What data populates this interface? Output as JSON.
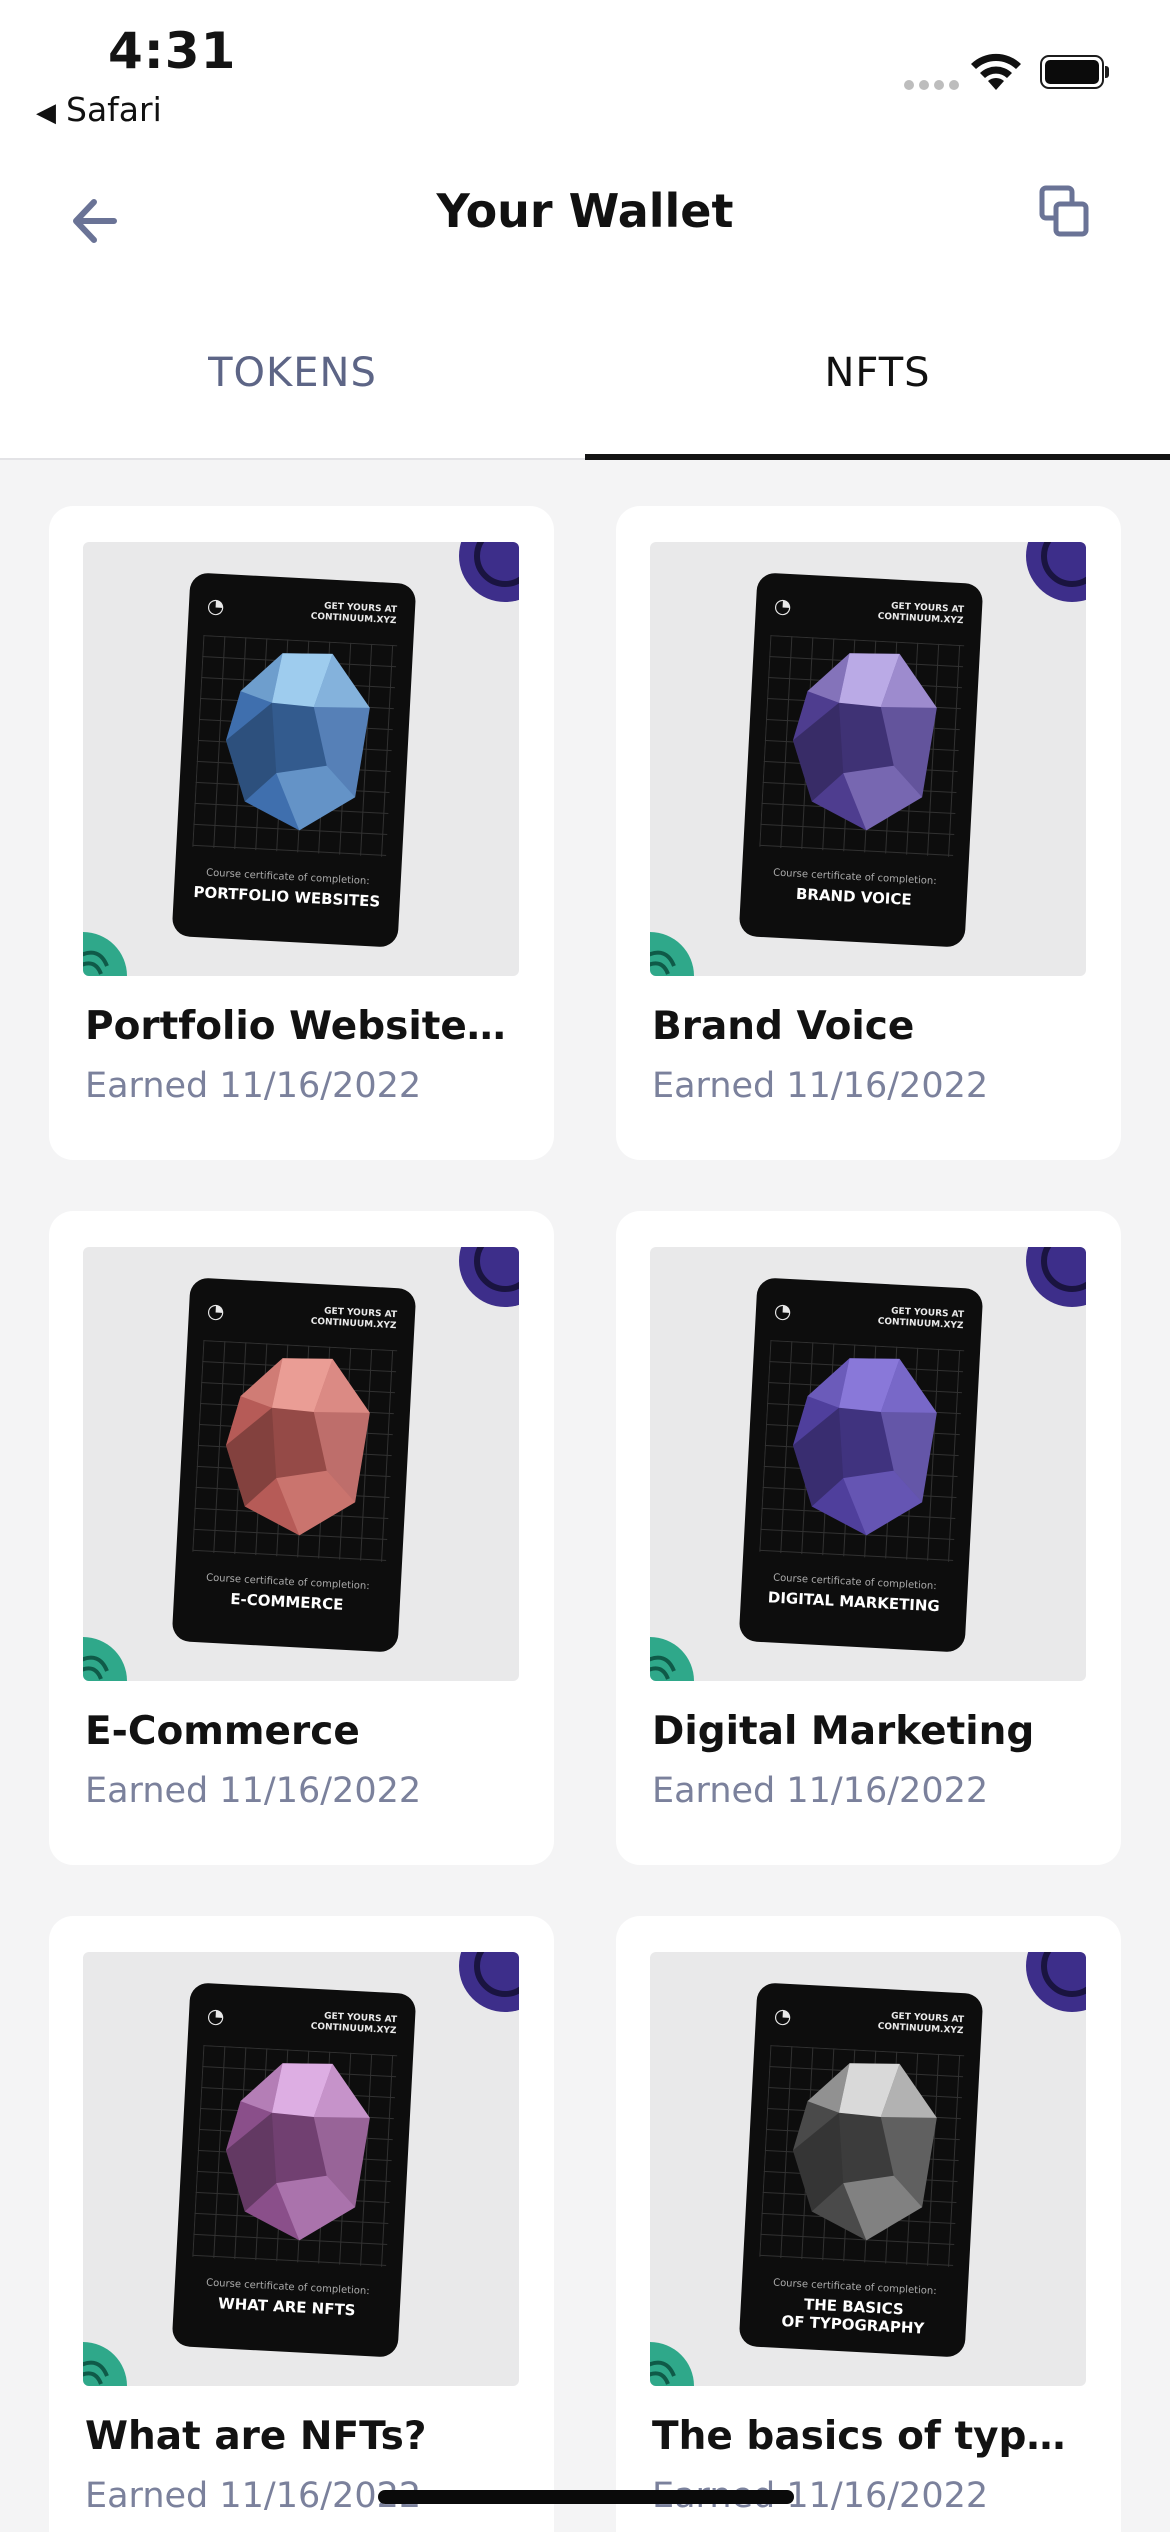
{
  "status": {
    "time": "4:31",
    "back_app": "Safari"
  },
  "header": {
    "title": "Your Wallet"
  },
  "tabs": [
    {
      "label": "TOKENS",
      "active": false
    },
    {
      "label": "NFTS",
      "active": true
    }
  ],
  "nft_card": {
    "promo_line1": "GET YOURS AT",
    "promo_line2": "CONTINUUM.XYZ",
    "cert_label": "Course certificate of completion:"
  },
  "nfts": [
    {
      "title": "Portfolio Websites y...",
      "date": "Earned 11/16/2022",
      "course_line1": "PORTFOLIO WEBSITES",
      "course_line2": "",
      "gem_color": "#3f6fae",
      "gem_light": "#a9d6f5"
    },
    {
      "title": "Brand Voice",
      "date": "Earned 11/16/2022",
      "course_line1": "BRAND VOICE",
      "course_line2": "",
      "gem_color": "#4e3d8f",
      "gem_light": "#c7b6f0"
    },
    {
      "title": "E-Commerce",
      "date": "Earned 11/16/2022",
      "course_line1": "E-COMMERCE",
      "course_line2": "",
      "gem_color": "#b65b57",
      "gem_light": "#f0a49c"
    },
    {
      "title": "Digital Marketing",
      "date": "Earned 11/16/2022",
      "course_line1": "DIGITAL MARKETING",
      "course_line2": "",
      "gem_color": "#4f3f9c",
      "gem_light": "#8f7ee0"
    },
    {
      "title": "What are NFTs?",
      "date": "Earned 11/16/2022",
      "course_line1": "WHAT ARE NFTS",
      "course_line2": "",
      "gem_color": "#8a4f8a",
      "gem_light": "#e6b8ec"
    },
    {
      "title": "The basics of typogr...",
      "date": "Earned 11/16/2022",
      "course_line1": "THE BASICS",
      "course_line2": "OF TYPOGRAPHY",
      "gem_color": "#4a4a4a",
      "gem_light": "#e9e9e9"
    }
  ],
  "colors": {
    "accent_badge": "#3d2e8a",
    "green_badge": "#2fa88a",
    "tab_inactive": "#5d6586",
    "date_text": "#7b819c"
  }
}
